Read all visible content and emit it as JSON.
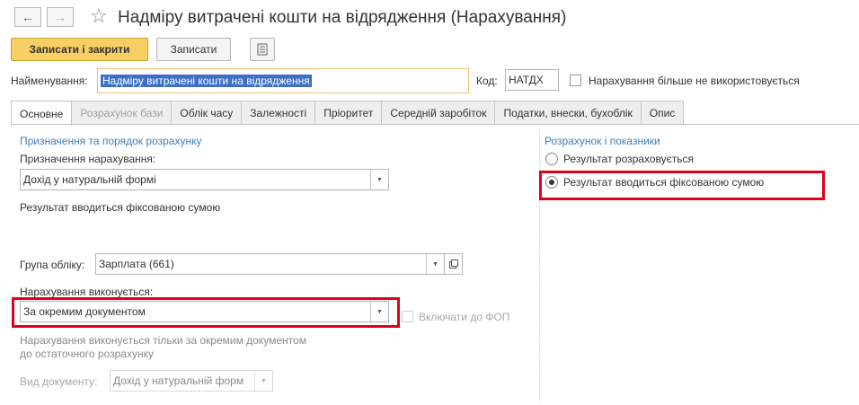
{
  "window": {
    "title": "Надміру витрачені кошти на відрядження (Нарахування)"
  },
  "nav": {
    "back": "←",
    "forward": "→",
    "star": "☆"
  },
  "toolbar": {
    "save_close": "Записати і закрити",
    "save": "Записати"
  },
  "header": {
    "name_label": "Найменування:",
    "name_value": "Надміру витрачені кошти на відрядження",
    "code_label": "Код:",
    "code_value": "НАТДХ",
    "unused_label": "Нарахування більше не використовується"
  },
  "tabs": [
    {
      "label": "Основне"
    },
    {
      "label": "Розрахунок бази"
    },
    {
      "label": "Облік часу"
    },
    {
      "label": "Залежності"
    },
    {
      "label": "Пріоритет"
    },
    {
      "label": "Середній заробіток"
    },
    {
      "label": "Податки, внески, бухоблік"
    },
    {
      "label": "Опис"
    }
  ],
  "left": {
    "section_title": "Призначення та порядок розрахунку",
    "purpose_label": "Призначення нарахування:",
    "purpose_value": "Дохід у натуральній формі",
    "fixed_note": "Результат вводиться фіксованою сумою",
    "group_label": "Група обліку:",
    "group_value": "Зарплата (661)",
    "exec_label": "Нарахування виконується:",
    "exec_value": "За окремим документом",
    "include_fop": "Включати до ФОП",
    "exec_note_1": "Нарахування виконується тільки за окремим документом",
    "exec_note_2": "до остаточного розрахунку",
    "doc_type_label": "Вид документу:",
    "doc_type_value": "Дохід у натуральній форм"
  },
  "right": {
    "section_title": "Розрахунок і показники",
    "radio_1": "Результат розраховується",
    "radio_2": "Результат вводиться фіксованою сумою",
    "selected": 2
  },
  "colors": {
    "accent_button": "#f7cf62",
    "highlight": "#e0001b",
    "section": "#3d7ebd",
    "selection": "#3d6fc9"
  }
}
